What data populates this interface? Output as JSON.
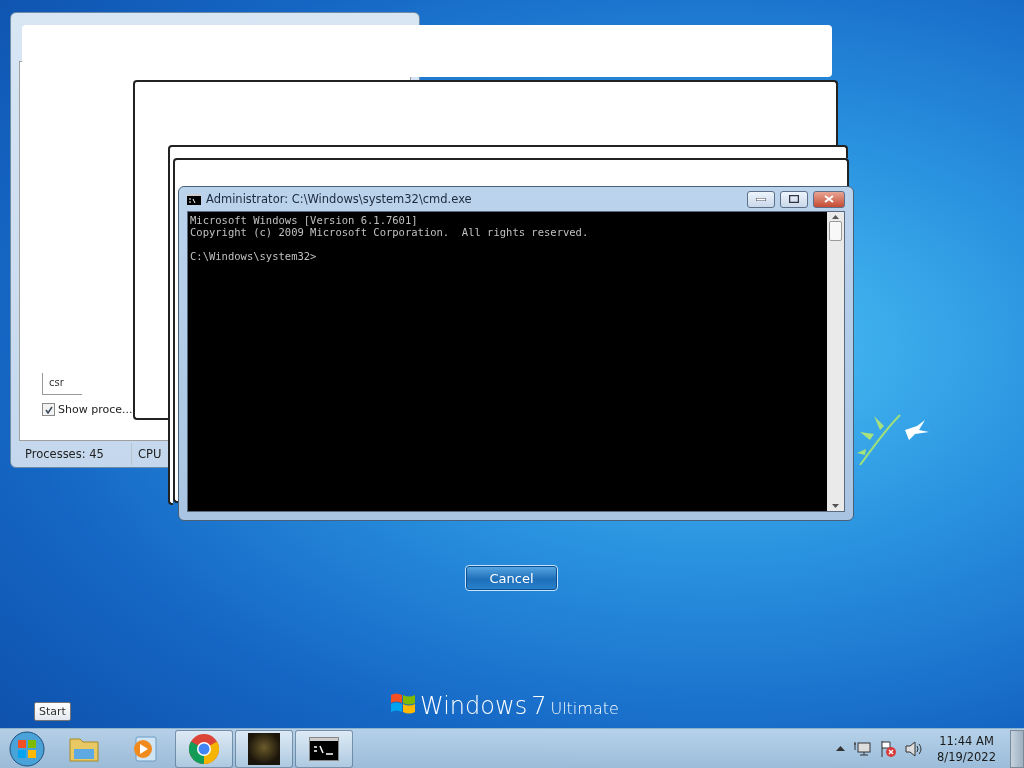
{
  "task_manager": {
    "filter_value": "csr",
    "show_processes": {
      "label": "Show proce...",
      "checked": true
    },
    "status_bar": [
      "Processes: 45",
      "CPU"
    ]
  },
  "cmd_window": {
    "title": "Administrator: C:\\Windows\\system32\\cmd.exe",
    "output": [
      "Microsoft Windows [Version 6.1.7601]",
      "Copyright (c) 2009 Microsoft Corporation.  All rights reserved."
    ],
    "prompt": "C:\\Windows\\system32>"
  },
  "cancel_button": "Cancel",
  "branding": {
    "name": "Windows",
    "version": "7",
    "edition": "Ultimate"
  },
  "tooltip": "Start",
  "taskbar": {
    "items": [
      {
        "kind": "start",
        "running": false
      },
      {
        "kind": "explorer",
        "running": false
      },
      {
        "kind": "media",
        "running": false
      },
      {
        "kind": "browser",
        "running": true
      },
      {
        "kind": "game",
        "running": true
      },
      {
        "kind": "console",
        "running": true
      }
    ],
    "clock": {
      "time": "11:44 AM",
      "date": "8/19/2022"
    }
  }
}
